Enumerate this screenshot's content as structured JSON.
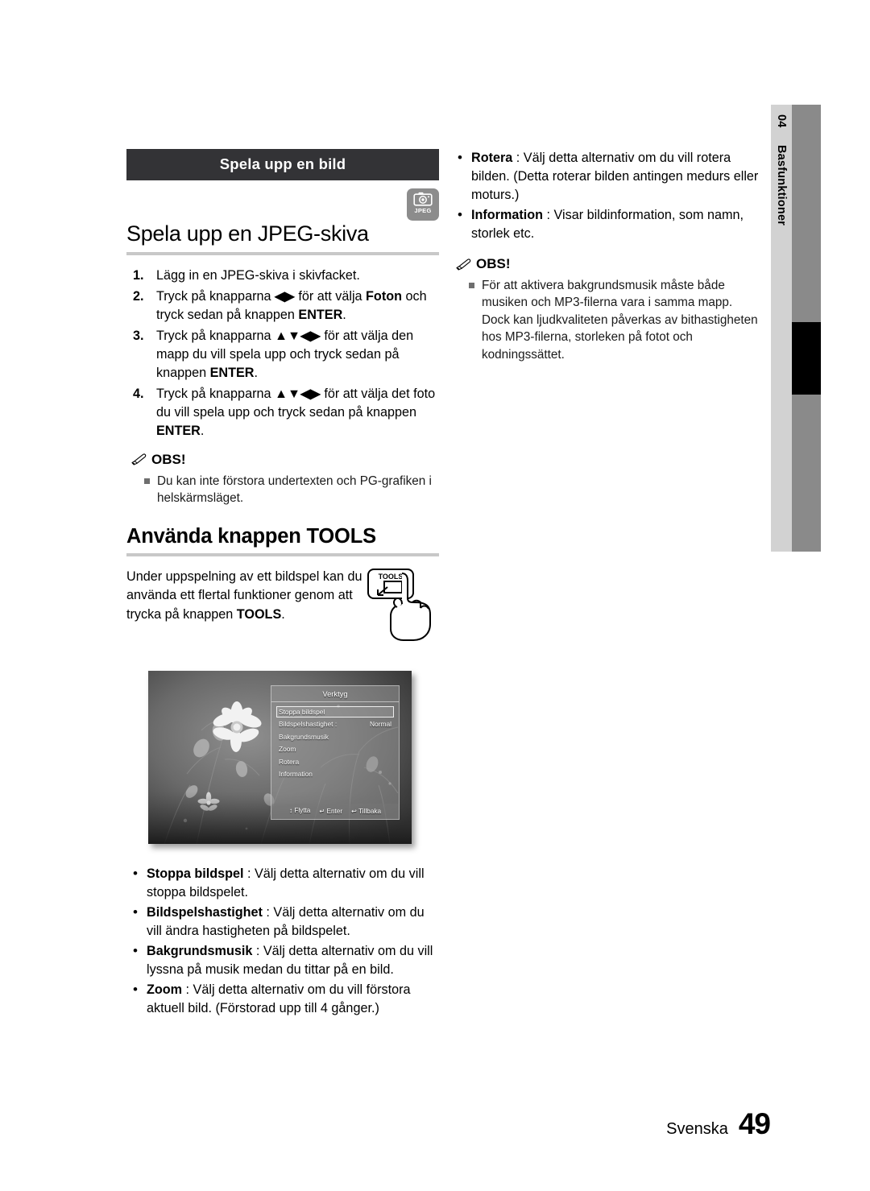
{
  "margin": {
    "chapter_number": "04",
    "chapter_name": "Basfunktioner"
  },
  "section": {
    "header_bar": "Spela upp en bild",
    "media_badge": {
      "icon": "camera-icon",
      "label": "JPEG"
    }
  },
  "left_column": {
    "heading_jpeg": "Spela upp en JPEG-skiva",
    "steps": [
      {
        "num": "1.",
        "html": "Lägg in en JPEG-skiva i skivfacket."
      },
      {
        "num": "2.",
        "html": "Tryck på knapparna <b>&#9664;&#9654;</b> för att välja <b>Foton</b> och tryck sedan på knappen <b>ENTER</b>."
      },
      {
        "num": "3.",
        "html": "Tryck på knapparna <b>&#9650;&#9660;&#9664;&#9654;</b> för att välja den mapp du vill spela upp och tryck sedan på knappen <b>ENTER</b>."
      },
      {
        "num": "4.",
        "html": "Tryck på knapparna <b>&#9650;&#9660;&#9664;&#9654;</b> för att välja det foto du vill spela upp och tryck sedan på knappen <b>ENTER</b>."
      }
    ],
    "note": {
      "title": "OBS!",
      "items": [
        "Du kan inte förstora undertexten och PG-grafiken i helskärmsläget."
      ]
    },
    "heading_tools": "Använda knappen TOOLS",
    "tools_paragraph_html": "Under uppspelning av ett bildspel kan du använda ett flertal funktioner genom att trycka på knappen <b>TOOLS</b>.",
    "tools_key_label": "TOOLS",
    "osd": {
      "title": "Verktyg",
      "items": [
        {
          "label": "Stoppa bildspel",
          "value": "",
          "selected": true
        },
        {
          "label": "Bildspelshastighet :",
          "value": "Normal",
          "selected": false
        },
        {
          "label": "Bakgrundsmusik",
          "value": "",
          "selected": false
        },
        {
          "label": "Zoom",
          "value": "",
          "selected": false
        },
        {
          "label": "Rotera",
          "value": "",
          "selected": false
        },
        {
          "label": "Information",
          "value": "",
          "selected": false
        }
      ],
      "footer": [
        {
          "icon": "updown-arrow-icon",
          "label": "Flytta"
        },
        {
          "icon": "enter-icon",
          "label": "Enter"
        },
        {
          "icon": "return-icon",
          "label": "Tillbaka"
        }
      ]
    },
    "bullets": [
      {
        "term": "Stoppa bildspel",
        "rest": " : Välj detta alternativ om du vill stoppa bildspelet."
      },
      {
        "term": "Bildspelshastighet",
        "rest": " : Välj detta alternativ om du vill ändra hastigheten på bildspelet."
      },
      {
        "term": "Bakgrundsmusik",
        "rest": " : Välj detta alternativ om du vill lyssna på musik medan du tittar på en bild."
      },
      {
        "term": "Zoom",
        "rest": " : Välj detta alternativ om du vill förstora aktuell bild. (Förstorad upp till 4 gånger.)"
      }
    ]
  },
  "right_column": {
    "bullets": [
      {
        "term": "Rotera",
        "rest": " : Välj detta alternativ om du vill rotera bilden. (Detta roterar bilden antingen medurs eller moturs.)"
      },
      {
        "term": "Information",
        "rest": " : Visar bildinformation, som namn, storlek etc."
      }
    ],
    "note": {
      "title": "OBS!",
      "items": [
        "För att aktivera bakgrundsmusik måste både musiken och MP3-filerna vara i samma mapp. Dock kan ljudkvaliteten påverkas av bithastigheten hos MP3-filerna, storleken på fotot och kodningssättet."
      ]
    }
  },
  "footer": {
    "language": "Svenska",
    "page_number": "49"
  },
  "colors": {
    "section_bar": "#333336",
    "rule": "#c8c8c8",
    "margin_tab": "#d2d2d2",
    "margin_bar": "#8a8a8a",
    "margin_active": "#000000",
    "badge": "#8c8c8c"
  }
}
